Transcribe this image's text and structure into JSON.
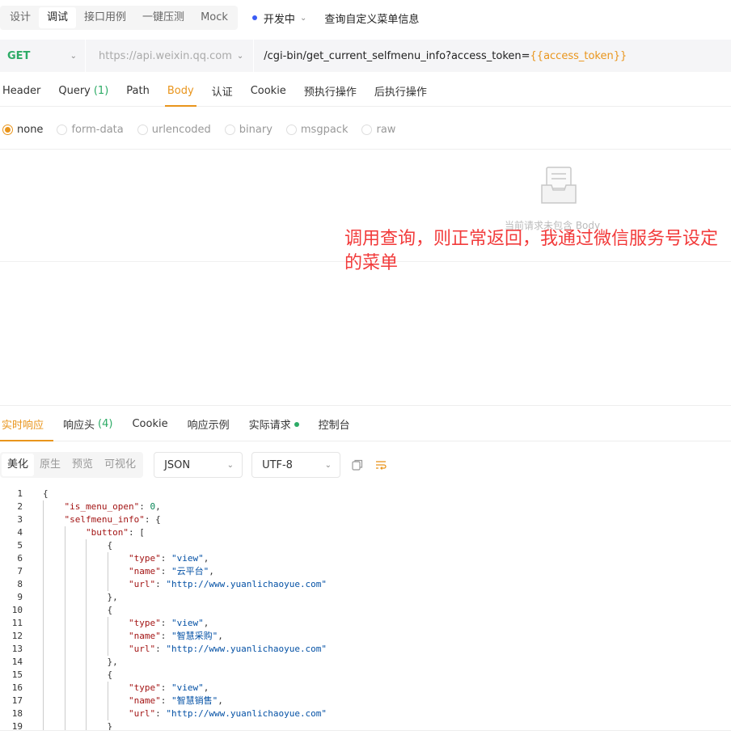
{
  "modes": [
    "设计",
    "调试",
    "接口用例",
    "一键压测",
    "Mock"
  ],
  "active_mode": "调试",
  "environment": "开发中",
  "page_title": "查询自定义菜单信息",
  "request": {
    "method": "GET",
    "base_url": "https://api.weixin.qq.com",
    "path": "/cgi-bin/get_current_selfmenu_info?access_token=",
    "path_variable": "{{access_token}}"
  },
  "request_tabs": {
    "header": "Header",
    "query": "Query",
    "query_count": "(1)",
    "path": "Path",
    "body": "Body",
    "auth": "认证",
    "cookie": "Cookie",
    "pre": "预执行操作",
    "post": "后执行操作"
  },
  "body_types": [
    "none",
    "form-data",
    "urlencoded",
    "binary",
    "msgpack",
    "raw"
  ],
  "empty_body_text": "当前请求未包含 Body",
  "annotation": "调用查询，则正常返回，我通过微信服务号设定的菜单",
  "response_tabs": {
    "realtime": "实时响应",
    "headers": "响应头",
    "headers_count": "(4)",
    "cookie": "Cookie",
    "example": "响应示例",
    "actual": "实际请求",
    "console": "控制台"
  },
  "view_modes": [
    "美化",
    "原生",
    "预览",
    "可视化"
  ],
  "format": "JSON",
  "encoding": "UTF-8",
  "icons": {
    "env": "dot",
    "copy": "copy-icon",
    "wrap": "wrap-icon",
    "empty": "empty-box-icon"
  },
  "colors": {
    "accent": "#e9951c",
    "method_get": "#2dab66",
    "annotation": "#f23b3b"
  },
  "code_lines": [
    {
      "n": "1",
      "indent": 0,
      "parts": [
        [
          "p",
          "{"
        ]
      ]
    },
    {
      "n": "2",
      "indent": 1,
      "parts": [
        [
          "k",
          "\"is_menu_open\""
        ],
        [
          "p",
          ": "
        ],
        [
          "num",
          "0"
        ],
        [
          "p",
          ","
        ]
      ]
    },
    {
      "n": "3",
      "indent": 1,
      "parts": [
        [
          "k",
          "\"selfmenu_info\""
        ],
        [
          "p",
          ": {"
        ]
      ]
    },
    {
      "n": "4",
      "indent": 2,
      "parts": [
        [
          "k",
          "\"button\""
        ],
        [
          "p",
          ": ["
        ]
      ]
    },
    {
      "n": "5",
      "indent": 3,
      "parts": [
        [
          "p",
          "{"
        ]
      ]
    },
    {
      "n": "6",
      "indent": 4,
      "parts": [
        [
          "k",
          "\"type\""
        ],
        [
          "p",
          ": "
        ],
        [
          "s",
          "\"view\""
        ],
        [
          "p",
          ","
        ]
      ]
    },
    {
      "n": "7",
      "indent": 4,
      "parts": [
        [
          "k",
          "\"name\""
        ],
        [
          "p",
          ": "
        ],
        [
          "s",
          "\"云平台\""
        ],
        [
          "p",
          ","
        ]
      ]
    },
    {
      "n": "8",
      "indent": 4,
      "parts": [
        [
          "k",
          "\"url\""
        ],
        [
          "p",
          ": "
        ],
        [
          "s",
          "\"http://www.yuanlichaoyue.com\""
        ]
      ]
    },
    {
      "n": "9",
      "indent": 3,
      "parts": [
        [
          "p",
          "},"
        ]
      ]
    },
    {
      "n": "10",
      "indent": 3,
      "parts": [
        [
          "p",
          "{"
        ]
      ]
    },
    {
      "n": "11",
      "indent": 4,
      "parts": [
        [
          "k",
          "\"type\""
        ],
        [
          "p",
          ": "
        ],
        [
          "s",
          "\"view\""
        ],
        [
          "p",
          ","
        ]
      ]
    },
    {
      "n": "12",
      "indent": 4,
      "parts": [
        [
          "k",
          "\"name\""
        ],
        [
          "p",
          ": "
        ],
        [
          "s",
          "\"智慧采购\""
        ],
        [
          "p",
          ","
        ]
      ]
    },
    {
      "n": "13",
      "indent": 4,
      "parts": [
        [
          "k",
          "\"url\""
        ],
        [
          "p",
          ": "
        ],
        [
          "s",
          "\"http://www.yuanlichaoyue.com\""
        ]
      ]
    },
    {
      "n": "14",
      "indent": 3,
      "parts": [
        [
          "p",
          "},"
        ]
      ]
    },
    {
      "n": "15",
      "indent": 3,
      "parts": [
        [
          "p",
          "{"
        ]
      ]
    },
    {
      "n": "16",
      "indent": 4,
      "parts": [
        [
          "k",
          "\"type\""
        ],
        [
          "p",
          ": "
        ],
        [
          "s",
          "\"view\""
        ],
        [
          "p",
          ","
        ]
      ]
    },
    {
      "n": "17",
      "indent": 4,
      "parts": [
        [
          "k",
          "\"name\""
        ],
        [
          "p",
          ": "
        ],
        [
          "s",
          "\"智慧销售\""
        ],
        [
          "p",
          ","
        ]
      ]
    },
    {
      "n": "18",
      "indent": 4,
      "parts": [
        [
          "k",
          "\"url\""
        ],
        [
          "p",
          ": "
        ],
        [
          "s",
          "\"http://www.yuanlichaoyue.com\""
        ]
      ]
    },
    {
      "n": "19",
      "indent": 3,
      "parts": [
        [
          "p",
          "}"
        ]
      ]
    }
  ]
}
